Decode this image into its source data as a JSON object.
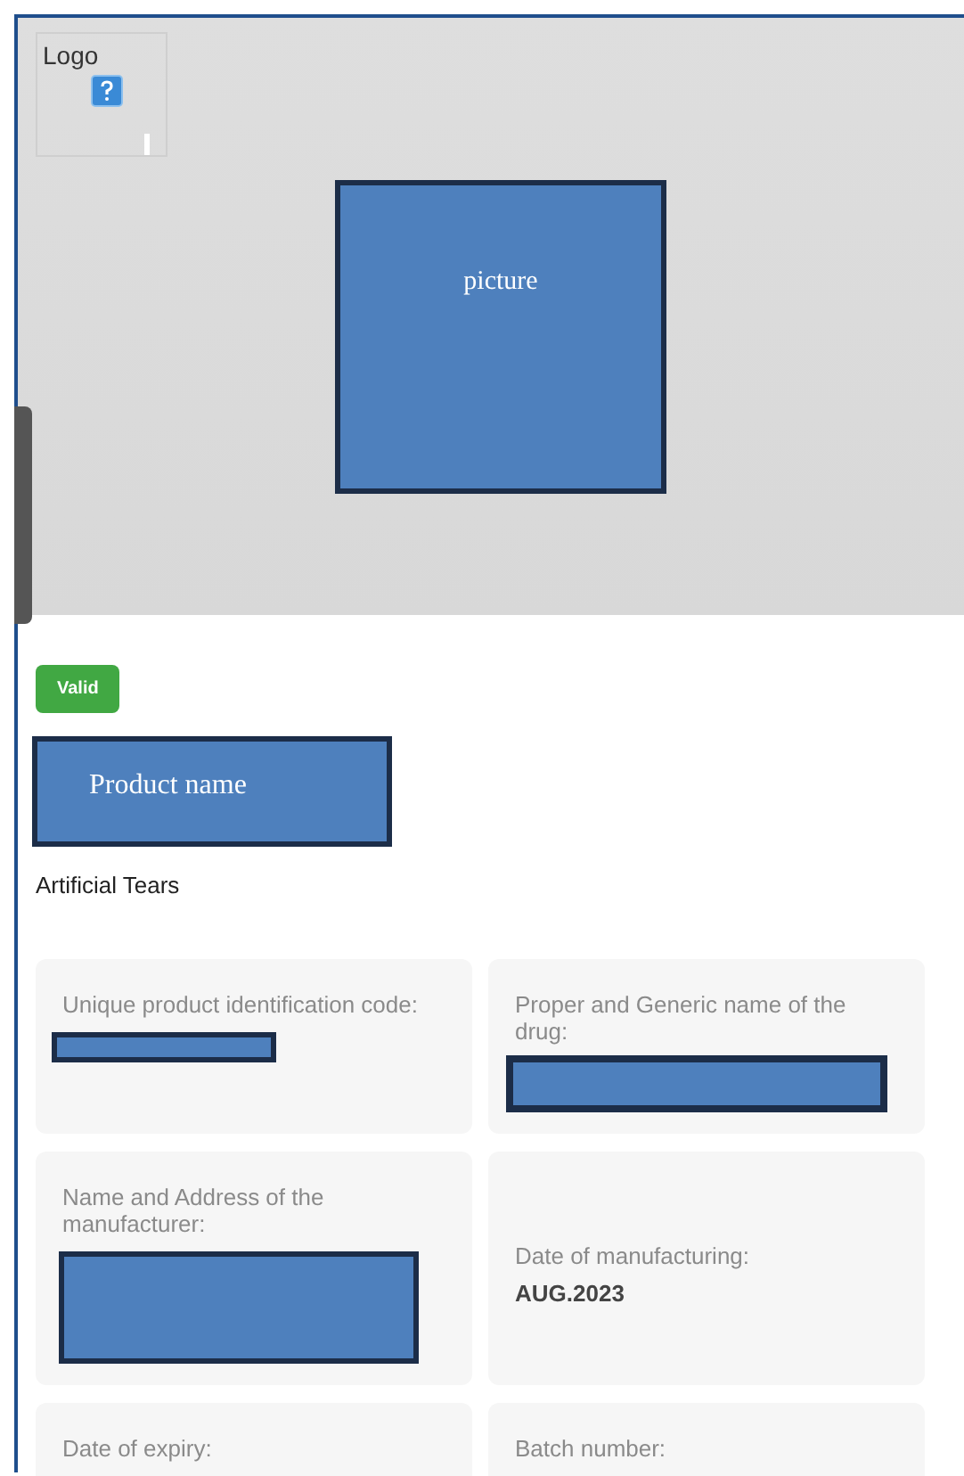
{
  "logo": {
    "label": "Logo"
  },
  "picture_placeholder": {
    "label": "picture"
  },
  "status_badge": {
    "label": "Valid"
  },
  "product_name_box": {
    "label": "Product name"
  },
  "product_title": "Artificial Tears",
  "fields": [
    {
      "label": "Unique product identification code:",
      "kind": "redacted-line"
    },
    {
      "label": "Proper and Generic name of the drug:",
      "kind": "redacted-bar"
    },
    {
      "label": "Name and Address of the manufacturer:",
      "kind": "redacted-block"
    },
    {
      "label": "Date of manufacturing:",
      "kind": "value",
      "value": "AUG.2023"
    },
    {
      "label": "Date of expiry:",
      "kind": "cut"
    },
    {
      "label": "Batch number:",
      "kind": "cut"
    }
  ]
}
